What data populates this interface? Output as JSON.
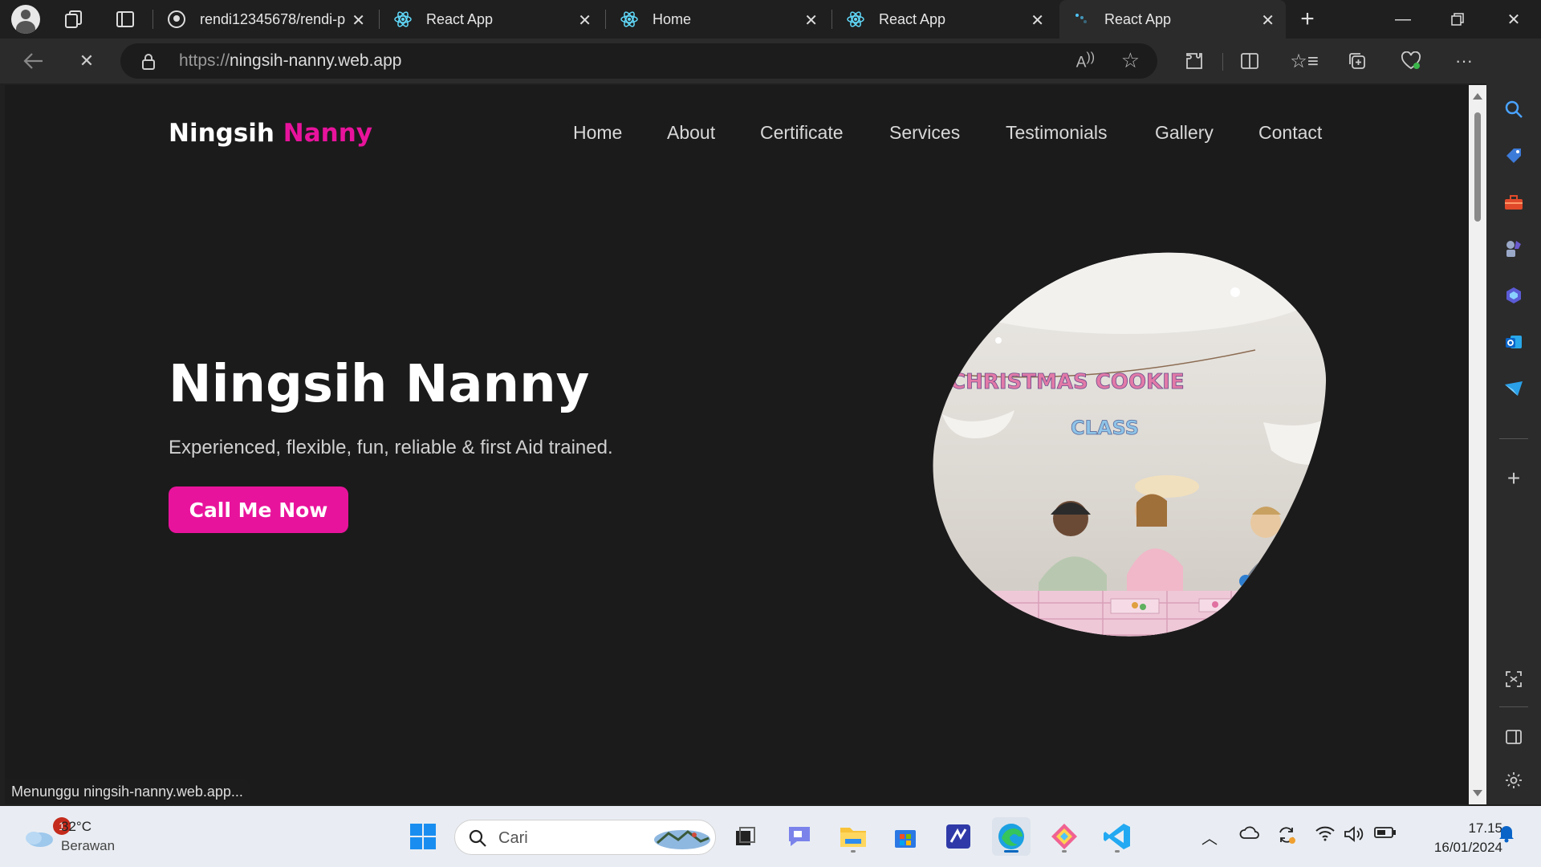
{
  "browser": {
    "tabs": [
      {
        "title": "rendi12345678/rendi-p",
        "icon": "github-icon"
      },
      {
        "title": "React App",
        "icon": "react-icon"
      },
      {
        "title": "Home",
        "icon": "react-icon"
      },
      {
        "title": "React App",
        "icon": "react-icon"
      },
      {
        "title": "React App",
        "icon": "loading-icon",
        "active": true
      }
    ],
    "url_scheme": "https://",
    "url_host": "ningsih-nanny.web.app",
    "status_text": "Menunggu ningsih-nanny.web.app..."
  },
  "site": {
    "logo_first": "Ningsih",
    "logo_second": "Nanny",
    "accent_color": "#e8139c",
    "nav": [
      "Home",
      "About",
      "Certificate",
      "Services",
      "Testimonials",
      "Gallery",
      "Contact"
    ],
    "hero_title": "Ningsih Nanny",
    "hero_subtitle": "Experienced, flexible, fun, reliable & first Aid trained.",
    "cta_label": "Call Me Now",
    "hero_image_banner_line1": "CHRISTMAS COOKIE",
    "hero_image_banner_line2": "CLASS"
  },
  "taskbar": {
    "weather_temp": "32°C",
    "weather_desc": "Berawan",
    "weather_badge": "1",
    "search_placeholder": "Cari",
    "time": "17.15",
    "date": "16/01/2024"
  }
}
